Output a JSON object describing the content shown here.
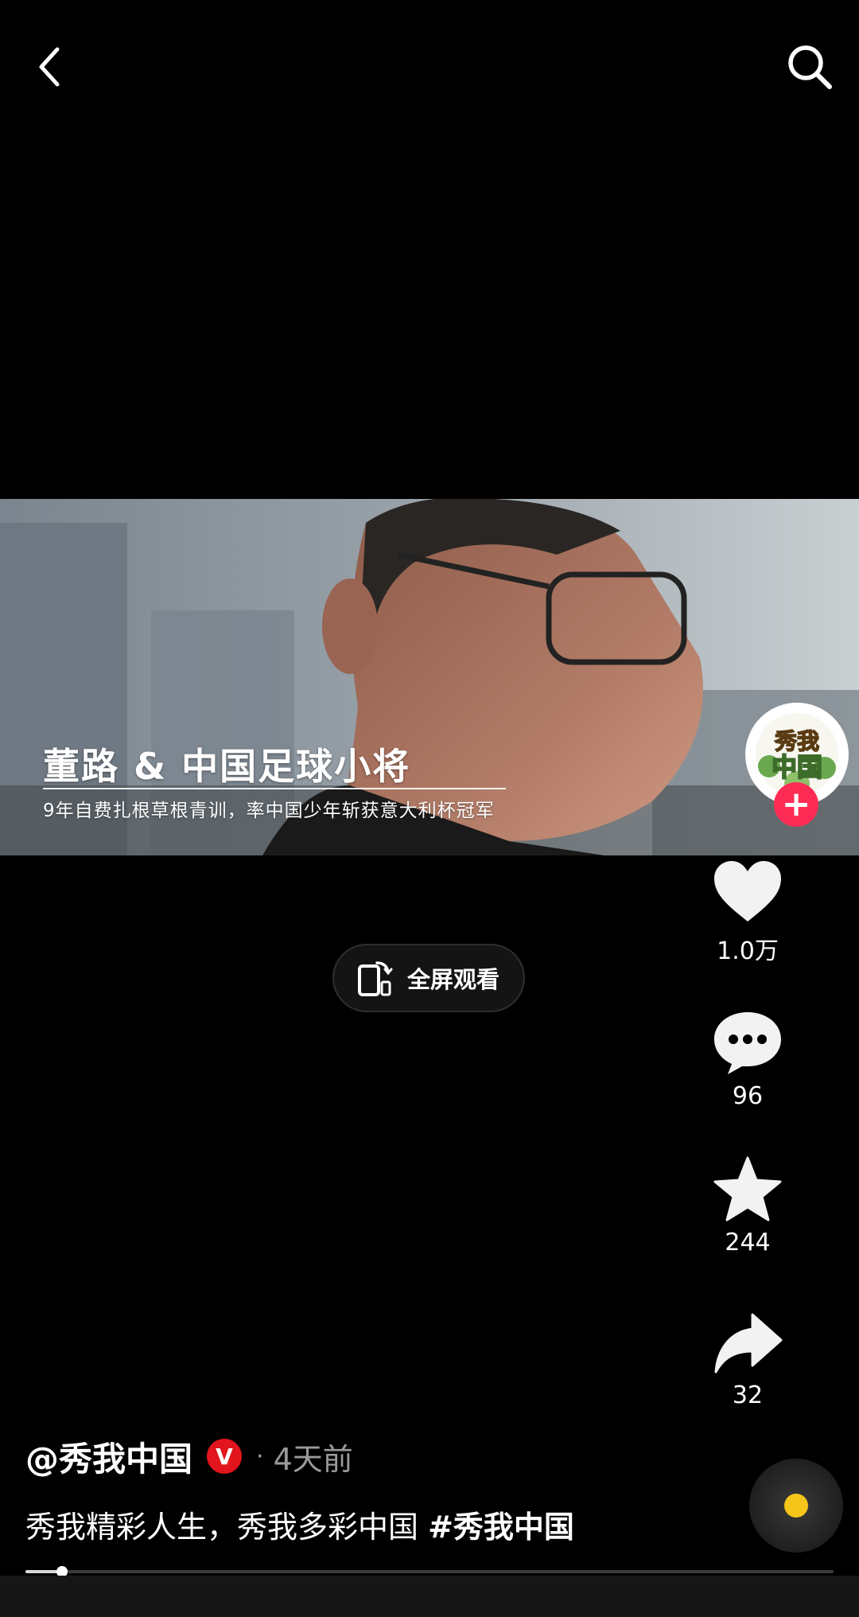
{
  "topbar": {
    "back_icon": "chevron-left-icon",
    "search_icon": "search-icon"
  },
  "video": {
    "title": "董路 & 中国足球小将",
    "subtitle": "9年自费扎根草根青训，率中国少年斩获意大利杯冠军"
  },
  "fullscreen": {
    "label": "全屏观看",
    "icon": "rotate-screen-icon"
  },
  "rail": {
    "avatar_text_line1": "秀我",
    "avatar_text_line2": "中国",
    "follow_label": "+",
    "like_count": "1.0万",
    "comment_count": "96",
    "favorite_count": "244",
    "share_count": "32"
  },
  "author": {
    "name": "@秀我中国",
    "verified_label": "V",
    "separator": "·",
    "time_ago": "4天前"
  },
  "caption": {
    "text": "秀我精彩人生，秀我多彩中国 ",
    "hashtag": "#秀我中国"
  },
  "progress": {
    "fraction": 0.045
  },
  "colors": {
    "background": "#000000",
    "accent_pink": "#fe2c55",
    "verified_red": "#e2151c",
    "disc_yellow": "#f5c51a"
  }
}
